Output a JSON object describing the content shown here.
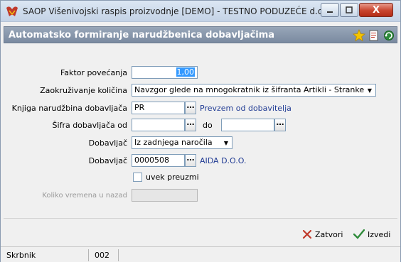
{
  "window": {
    "title": "SAOP Višenivojski raspis proizvodnje [DEMO] - TESTNO PODUZEĆE d.o...",
    "close_label": "X"
  },
  "header": {
    "title": "Automatsko formiranje narudžbenica dobavljačima",
    "icons": [
      "star-icon",
      "document-icon",
      "refresh-icon"
    ]
  },
  "form": {
    "faktor": {
      "label": "Faktor povećanja",
      "value": "1,00"
    },
    "zaokruzivanje": {
      "label": "Zaokruživanje količina",
      "value": "Navzgor glede na mnogokratnik iz šifranta Artikli - Stranke"
    },
    "knjiga": {
      "label": "Knjiga narudžbina dobavljača",
      "value": "PR",
      "link": "Prevzem od dobavitelja"
    },
    "sifra": {
      "label": "Šifra dobavljača od",
      "from_value": "",
      "to_label": "do",
      "to_value": ""
    },
    "dobavljac_mode": {
      "label": "Dobavljač",
      "value": "Iz zadnjega naročila"
    },
    "dobavljac": {
      "label": "Dobavljač",
      "value": "0000508",
      "link": "AIDA D.O.O."
    },
    "uvek": {
      "label": "uvek preuzmi",
      "checked": false
    },
    "koliko": {
      "label": "Koliko vremena u nazad",
      "value": ""
    }
  },
  "actions": {
    "zatvori": "Zatvori",
    "izvedi": "Izvedi"
  },
  "statusbar": {
    "user": "Skrbnik",
    "code": "002"
  }
}
